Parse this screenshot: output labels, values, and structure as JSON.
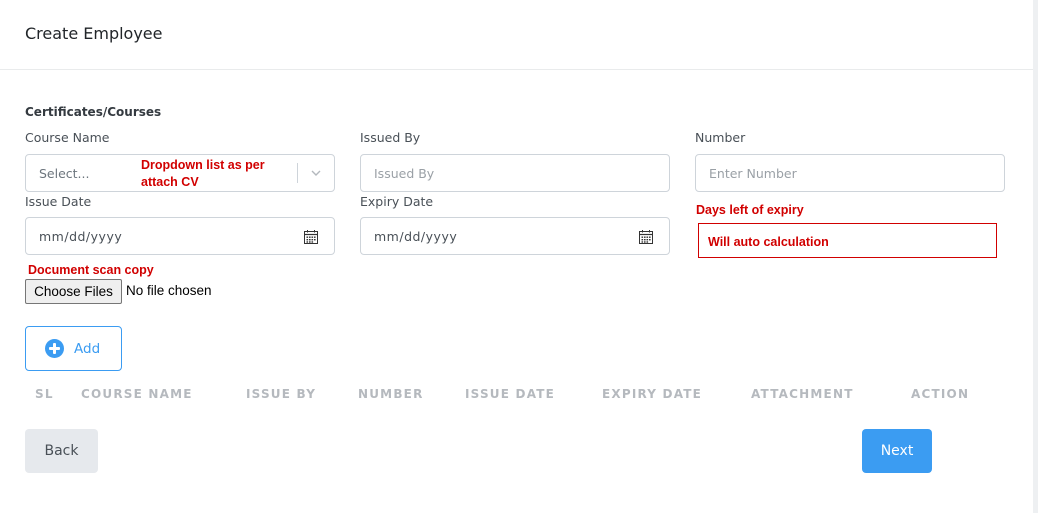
{
  "header": {
    "title": "Create Employee"
  },
  "section": {
    "title": "Certificates/Courses"
  },
  "fields": {
    "course_name": {
      "label": "Course Name",
      "placeholder": "Select..."
    },
    "issued_by": {
      "label": "Issued By",
      "placeholder": "Issued By"
    },
    "number": {
      "label": "Number",
      "placeholder": "Enter Number"
    },
    "issue_date": {
      "label": "Issue Date",
      "value": "mm/dd/yyyy"
    },
    "expiry_date": {
      "label": "Expiry Date",
      "value": "mm/dd/yyyy"
    },
    "file": {
      "button_label": "Choose Files",
      "status": "No file chosen"
    }
  },
  "annotations": {
    "dropdown_note_line1": "Dropdown list as per",
    "dropdown_note_line2": "attach CV",
    "days_left_label": "Days left of expiry",
    "auto_calc": "Will auto calculation",
    "document_scan": "Document scan copy"
  },
  "add_button": {
    "label": "Add"
  },
  "table": {
    "columns": [
      "SL",
      "COURSE NAME",
      "ISSUE BY",
      "NUMBER",
      "ISSUE DATE",
      "EXPIRY DATE",
      "ATTACHMENT",
      "ACTION"
    ]
  },
  "footer": {
    "back_label": "Back",
    "next_label": "Next"
  },
  "colors": {
    "accent": "#3b9cf2",
    "annotation_red": "#d10000"
  },
  "icons": {
    "select_chevron": "chevron-down-icon",
    "date_picker": "calendar-icon",
    "add": "plus-circle-icon"
  }
}
